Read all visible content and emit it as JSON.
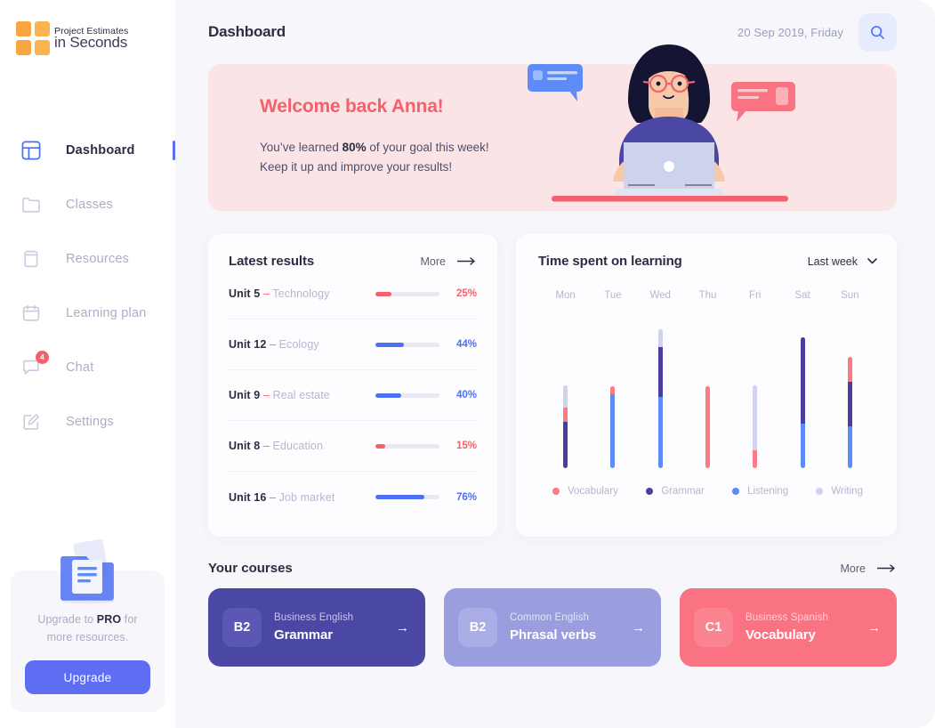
{
  "brand": {
    "line1": "Project Estimates",
    "line2": "in Seconds",
    "color": "#f9a43f"
  },
  "sidebar": {
    "items": [
      {
        "label": "Dashboard",
        "icon": "layout-icon",
        "active": true
      },
      {
        "label": "Classes",
        "icon": "folder-icon",
        "active": false
      },
      {
        "label": "Resources",
        "icon": "book-icon",
        "active": false
      },
      {
        "label": "Learning plan",
        "icon": "calendar-icon",
        "active": false
      },
      {
        "label": "Chat",
        "icon": "chat-icon",
        "active": false,
        "badge": "4"
      },
      {
        "label": "Settings",
        "icon": "edit-icon",
        "active": false
      }
    ],
    "upgrade": {
      "text_before": "Upgrade to ",
      "text_bold": "PRO",
      "text_after": " for more resources.",
      "button": "Upgrade"
    }
  },
  "header": {
    "title": "Dashboard",
    "date": "20 Sep 2019, Friday",
    "search_icon": "search-icon"
  },
  "welcome": {
    "title": "Welcome back Anna!",
    "line1_before": "You’ve learned ",
    "line1_bold": "80%",
    "line1_after": " of your goal this week!",
    "line2": "Keep it up and improve your results!"
  },
  "latest_results": {
    "title": "Latest results",
    "more_label": "More",
    "rows": [
      {
        "unit": "Unit 5",
        "dash": " – ",
        "topic": "Technology",
        "percent": "25%",
        "value": 25,
        "color": "#f4606c"
      },
      {
        "unit": "Unit 12",
        "dash": " – ",
        "topic": "Ecology",
        "percent": "44%",
        "value": 44,
        "color": "#4d6ff3"
      },
      {
        "unit": "Unit 9",
        "dash": " – ",
        "topic": "Real estate",
        "percent": "40%",
        "value": 40,
        "color": "#4d6ff3"
      },
      {
        "unit": "Unit 8",
        "dash": " – ",
        "topic": "Education",
        "percent": "15%",
        "value": 15,
        "color": "#f4606c"
      },
      {
        "unit": "Unit 16",
        "dash": " – ",
        "topic": "Job market",
        "percent": "76%",
        "value": 76,
        "color": "#4d6ff3"
      }
    ]
  },
  "chart_data": {
    "type": "bar",
    "title": "Time spent on learning",
    "period_label": "Last week",
    "stacked": true,
    "categories": [
      "Mon",
      "Tue",
      "Wed",
      "Thu",
      "Fri",
      "Sat",
      "Sun"
    ],
    "series": [
      {
        "name": "Vocabulary",
        "color": "#fc7a84",
        "values": [
          16,
          9,
          0,
          92,
          20,
          0,
          28
        ]
      },
      {
        "name": "Grammar",
        "color": "#4a3f9e",
        "values": [
          52,
          0,
          56,
          0,
          0,
          97,
          50
        ]
      },
      {
        "name": "Listening",
        "color": "#5d8bf7",
        "values": [
          0,
          83,
          80,
          0,
          0,
          50,
          47
        ]
      },
      {
        "name": "Writing",
        "color": "#cfd3f0",
        "values": [
          25,
          0,
          20,
          0,
          73,
          0,
          0
        ]
      }
    ],
    "bar_order_top_to_bottom": [
      "Writing",
      "Vocabulary",
      "Grammar",
      "Listening"
    ],
    "ylabel": "",
    "xlabel": "",
    "grid": false,
    "legend_position": "bottom",
    "axis_labels_visible": true
  },
  "courses": {
    "title": "Your courses",
    "more_label": "More",
    "items": [
      {
        "level": "B2",
        "sub": "Business English",
        "name": "Grammar",
        "bg": "#4b47a5",
        "level_bg": "#5b57b4",
        "text": "#ffffff",
        "sub_color": "#c9c6ec"
      },
      {
        "level": "B2",
        "sub": "Common English",
        "name": "Phrasal verbs",
        "bg": "#9a9ede",
        "level_bg": "#aaade6",
        "text": "#ffffff",
        "sub_color": "#e4e5f8"
      },
      {
        "level": "C1",
        "sub": "Business Spanish",
        "name": "Vocabulary",
        "bg": "#fa7382",
        "level_bg": "#fb8491",
        "text": "#ffffff",
        "sub_color": "#ffd3d8"
      }
    ]
  }
}
